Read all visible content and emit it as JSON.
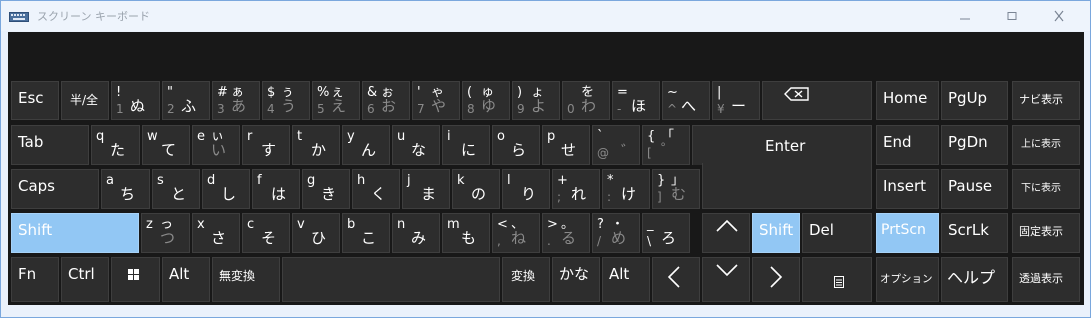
{
  "window": {
    "title": "スクリーン キーボード",
    "controls": {
      "minimize": "minimize-icon",
      "maximize": "maximize-icon",
      "close": "close-icon"
    }
  },
  "keys": {
    "esc": "Esc",
    "hankaku": "半/全",
    "k1": {
      "top": "!",
      "bottom": "1",
      "kana": "ぬ"
    },
    "k2": {
      "top": "\"",
      "bottom": "2",
      "kana": "ふ"
    },
    "k3": {
      "top": "#",
      "top_kana": "ぁ",
      "bottom": "3",
      "kana": "あ"
    },
    "k4": {
      "top": "$",
      "top_kana": "ぅ",
      "bottom": "4",
      "kana": "う"
    },
    "k5": {
      "top": "%",
      "top_kana": "ぇ",
      "bottom": "5",
      "kana": "え"
    },
    "k6": {
      "top": "&",
      "top_kana": "ぉ",
      "bottom": "6",
      "kana": "お"
    },
    "k7": {
      "top": "'",
      "top_kana": "ゃ",
      "bottom": "7",
      "kana": "や"
    },
    "k8": {
      "top": "(",
      "top_kana": "ゅ",
      "bottom": "8",
      "kana": "ゆ"
    },
    "k9": {
      "top": ")",
      "top_kana": "ょ",
      "bottom": "9",
      "kana": "よ"
    },
    "k0": {
      "top_kana": "を",
      "bottom": "0",
      "kana": "わ"
    },
    "minus": {
      "top": "=",
      "bottom": "-",
      "kana": "ほ"
    },
    "caret": {
      "top": "~",
      "bottom": "^",
      "kana": "へ"
    },
    "yen": {
      "top": "|",
      "bottom": "¥",
      "kana": "ー"
    },
    "backspace": "backspace-icon",
    "tab": "Tab",
    "q": {
      "letter": "q",
      "kana": "た"
    },
    "w": {
      "letter": "w",
      "kana": "て"
    },
    "e": {
      "letter": "e",
      "top_kana": "ぃ",
      "kana": "い"
    },
    "r": {
      "letter": "r",
      "kana": "す"
    },
    "t": {
      "letter": "t",
      "kana": "か"
    },
    "y": {
      "letter": "y",
      "kana": "ん"
    },
    "u": {
      "letter": "u",
      "kana": "な"
    },
    "i": {
      "letter": "i",
      "kana": "に"
    },
    "o": {
      "letter": "o",
      "kana": "ら"
    },
    "p": {
      "letter": "p",
      "kana": "せ"
    },
    "at": {
      "top": "`",
      "bottom": "@",
      "kana": "゛"
    },
    "lbracket": {
      "top": "{",
      "top_kana": "「",
      "bottom": "[",
      "kana": "゜"
    },
    "enter": "Enter",
    "caps": "Caps",
    "a": {
      "letter": "a",
      "kana": "ち"
    },
    "s": {
      "letter": "s",
      "kana": "と"
    },
    "d": {
      "letter": "d",
      "kana": "し"
    },
    "f": {
      "letter": "f",
      "kana": "は"
    },
    "g": {
      "letter": "g",
      "kana": "き"
    },
    "h": {
      "letter": "h",
      "kana": "く"
    },
    "j": {
      "letter": "j",
      "kana": "ま"
    },
    "k": {
      "letter": "k",
      "kana": "の"
    },
    "l": {
      "letter": "l",
      "kana": "り"
    },
    "semicolon": {
      "top": "+",
      "bottom": ";",
      "kana": "れ"
    },
    "colon": {
      "top": "*",
      "bottom": ":",
      "kana": "け"
    },
    "rbracket": {
      "top": "}",
      "top_kana": "」",
      "bottom": "]",
      "kana": "む"
    },
    "shift_l": "Shift",
    "z": {
      "letter": "z",
      "top_kana": "っ",
      "kana": "つ"
    },
    "x": {
      "letter": "x",
      "kana": "さ"
    },
    "c": {
      "letter": "c",
      "kana": "そ"
    },
    "v": {
      "letter": "v",
      "kana": "ひ"
    },
    "b": {
      "letter": "b",
      "kana": "こ"
    },
    "n": {
      "letter": "n",
      "kana": "み"
    },
    "m": {
      "letter": "m",
      "kana": "も"
    },
    "comma": {
      "top": "<",
      "top_kana": "、",
      "bottom": ",",
      "kana": "ね"
    },
    "period": {
      "top": ">",
      "top_kana": "。",
      "bottom": ".",
      "kana": "る"
    },
    "slash": {
      "top": "?",
      "top_kana": "・",
      "bottom": "/",
      "kana": "め"
    },
    "backslash": {
      "top": "_",
      "bottom": "\\",
      "kana": "ろ"
    },
    "up": "up-arrow-icon",
    "shift_r": "Shift",
    "del": "Del",
    "fn": "Fn",
    "ctrl": "Ctrl",
    "win": "windows-icon",
    "alt_l": "Alt",
    "muhenkan": "無変換",
    "henkan": "変換",
    "kana_key": "かな",
    "alt_r": "Alt",
    "left": "left-arrow-icon",
    "down": "down-arrow-icon",
    "right": "right-arrow-icon",
    "menu": "context-menu-icon",
    "home": "Home",
    "pgup": "PgUp",
    "navi": "ナビ表示",
    "end": "End",
    "pgdn": "PgDn",
    "upper_show": "上に表示",
    "insert": "Insert",
    "pause": "Pause",
    "lower_show": "下に表示",
    "prtscn": "PrtScn",
    "scrlk": "ScrLk",
    "fixed_show": "固定表示",
    "options": "オプション",
    "help": "ヘルプ",
    "transparent": "透過表示"
  },
  "colors": {
    "highlight": "#92c7f4",
    "key": "#2d2d2d",
    "keyboard_bg": "#181818"
  }
}
